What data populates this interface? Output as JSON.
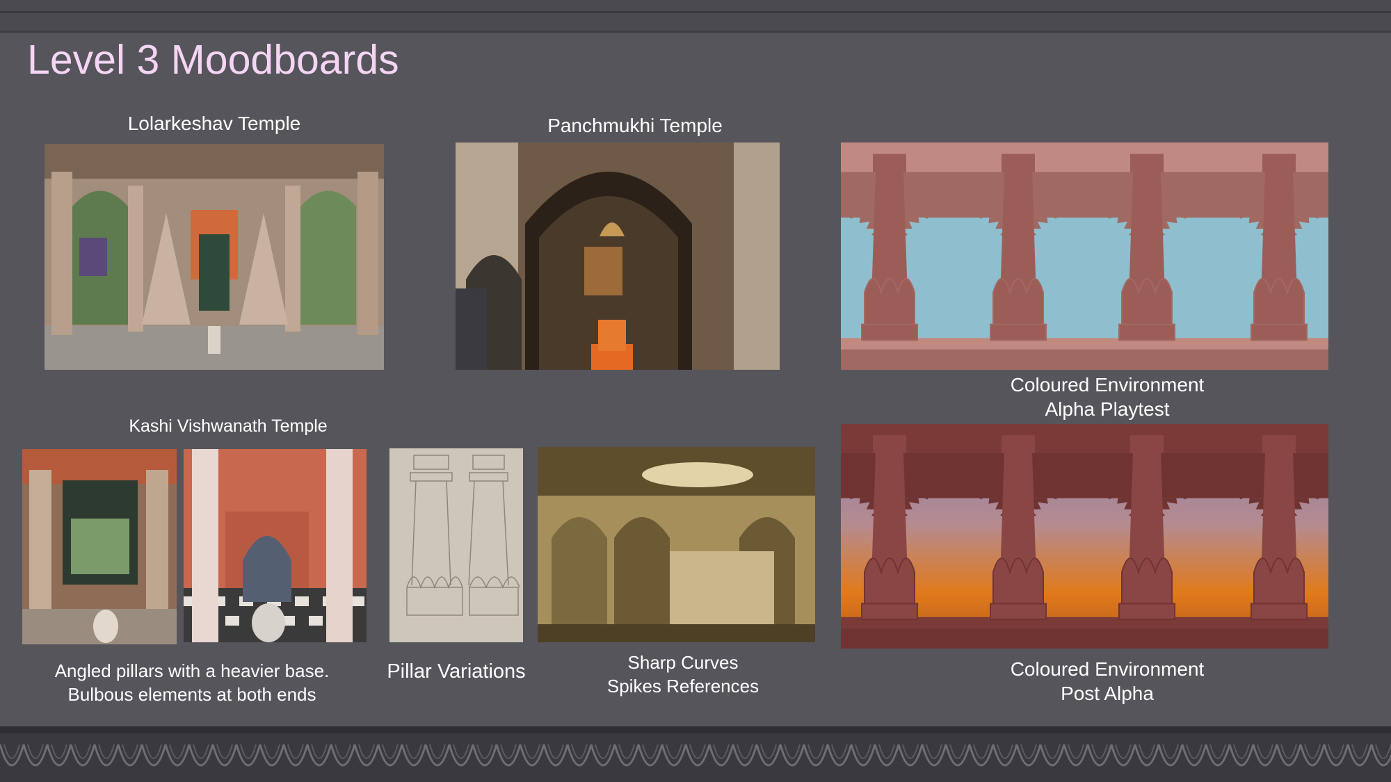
{
  "slide": {
    "title": "Level 3 Moodboards",
    "captions": {
      "lolarkeshav": "Lolarkeshav Temple",
      "panchmukhi": "Panchmukhi Temple",
      "kashi": "Kashi Vishwanath Temple",
      "angled_line1": "Angled pillars with a heavier base.",
      "angled_line2": "Bulbous elements at both ends",
      "pillar_variations": "Pillar Variations",
      "sharp_line1": "Sharp Curves",
      "sharp_line2": "Spikes References",
      "alpha_line1": "Coloured Environment",
      "alpha_line2": "Alpha Playtest",
      "post_line1": "Coloured Environment",
      "post_line2": "Post Alpha"
    }
  },
  "colors": {
    "background": "#56555b",
    "title": "#f4d6f4",
    "caption": "#ffffff",
    "pillar": "#9c5d57",
    "pillar_dark": "#6f3432",
    "sky_alpha": "#8fbfce",
    "sky_post_top": "#8a7fb0",
    "sky_post_bottom": "#e07a1c"
  }
}
